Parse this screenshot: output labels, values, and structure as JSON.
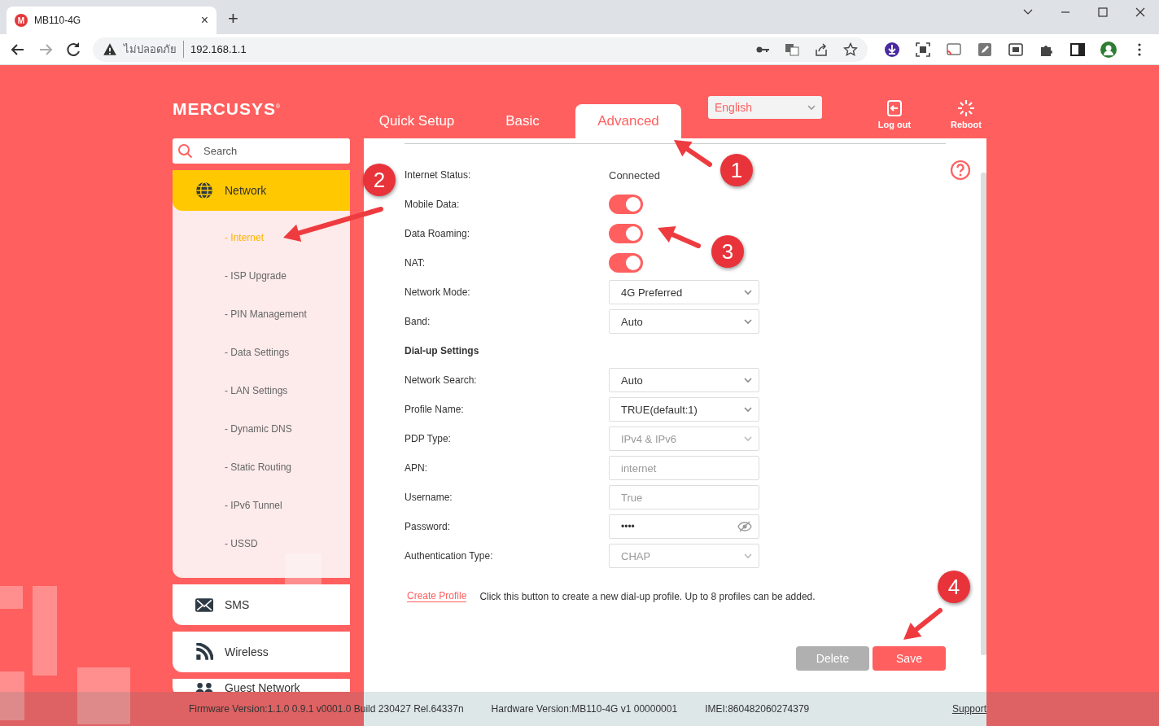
{
  "browser": {
    "tab_favicon": "M",
    "tab_title": "MB110-4G",
    "tab_close": "×",
    "new_tab": "+",
    "security_label": "ไม่ปลอดภัย",
    "url": "192.168.1.1"
  },
  "header": {
    "logo": "MERCUSYS$^{®}$",
    "tabs": [
      {
        "label": "Quick Setup",
        "selected": false
      },
      {
        "label": "Basic",
        "selected": false
      },
      {
        "label": "Advanced",
        "selected": true
      }
    ],
    "language": "English",
    "actions": [
      {
        "label": "Log out",
        "kind": "logout"
      },
      {
        "label": "Reboot",
        "kind": "reboot"
      }
    ]
  },
  "sidebar": {
    "search_placeholder": "Search",
    "sections": [
      {
        "label": "Network",
        "kind": "globe",
        "expanded": true,
        "children": [
          {
            "label": "- Internet",
            "selected": true
          },
          {
            "label": "- ISP Upgrade",
            "selected": false
          },
          {
            "label": "- PIN Management",
            "selected": false
          },
          {
            "label": "- Data Settings",
            "selected": false
          },
          {
            "label": "- LAN Settings",
            "selected": false
          },
          {
            "label": "- Dynamic DNS",
            "selected": false
          },
          {
            "label": "- Static Routing",
            "selected": false
          },
          {
            "label": "- IPv6 Tunnel",
            "selected": false
          },
          {
            "label": "- USSD",
            "selected": false
          }
        ]
      },
      {
        "label": "SMS",
        "kind": "envelope",
        "expanded": false
      },
      {
        "label": "Wireless",
        "kind": "signal",
        "expanded": false
      },
      {
        "label": "Guest Network",
        "kind": "people",
        "expanded": false
      }
    ]
  },
  "form": {
    "rows": [
      {
        "kind": "text",
        "label": "Internet Status:",
        "value": "Connected"
      },
      {
        "kind": "toggle",
        "label": "Mobile Data:",
        "on": true
      },
      {
        "kind": "toggle",
        "label": "Data Roaming:",
        "on": true
      },
      {
        "kind": "toggle",
        "label": "NAT:",
        "on": true
      },
      {
        "kind": "select",
        "label": "Network Mode:",
        "value": "4G Preferred",
        "disabled": false
      },
      {
        "kind": "select",
        "label": "Band:",
        "value": "Auto",
        "disabled": false
      },
      {
        "kind": "heading",
        "label": "Dial-up Settings"
      },
      {
        "kind": "select",
        "label": "Network Search:",
        "value": "Auto",
        "disabled": false
      },
      {
        "kind": "select",
        "label": "Profile Name:",
        "value": "TRUE(default:1)",
        "disabled": false
      },
      {
        "kind": "select",
        "label": "PDP Type:",
        "value": "IPv4 & IPv6",
        "disabled": true
      },
      {
        "kind": "input",
        "label": "APN:",
        "value": "internet",
        "disabled": true
      },
      {
        "kind": "input",
        "label": "Username:",
        "value": "True",
        "disabled": true
      },
      {
        "kind": "password",
        "label": "Password:",
        "value": "••••",
        "disabled": false
      },
      {
        "kind": "select",
        "label": "Authentication Type:",
        "value": "CHAP",
        "disabled": true
      }
    ],
    "create_profile": {
      "link": "Create Profile",
      "hint": "Click this button to create a new dial-up profile. Up to 8 profiles can be added."
    },
    "buttons": [
      {
        "label": "Delete",
        "kind": "secondary"
      },
      {
        "label": "Save",
        "kind": "primary"
      }
    ]
  },
  "footer": {
    "firmware": "Firmware Version:1.1.0 0.9.1 v0001.0 Build 230427 Rel.64337n",
    "hardware": "Hardware Version:MB110-4G v1 00000001",
    "imei": "IMEI:860482060274379",
    "support": "Support"
  },
  "annotations": [
    {
      "label": "1"
    },
    {
      "label": "2"
    },
    {
      "label": "3"
    },
    {
      "label": "4"
    }
  ]
}
